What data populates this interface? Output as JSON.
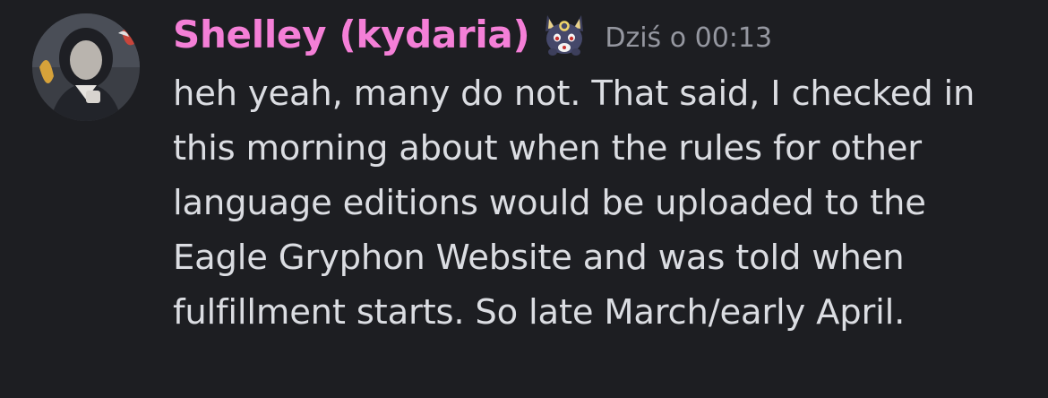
{
  "message": {
    "author": "Shelley (kydaria)",
    "timestamp": "Dziś o 00:13",
    "lines": [
      "heh yeah, many do not.  That said, I checked in",
      "this morning about when the rules for other",
      "language editions would be uploaded to the",
      "Eagle Gryphon Website and was told when",
      "fulfillment starts. So late March/early April."
    ],
    "author_color": "#f47fd7",
    "text_color": "#dbdde2",
    "timestamp_color": "#9597a0",
    "background_color": "#1d1e22"
  },
  "icons": {
    "avatar": "user-avatar",
    "badge": "creature-badge-icon"
  }
}
